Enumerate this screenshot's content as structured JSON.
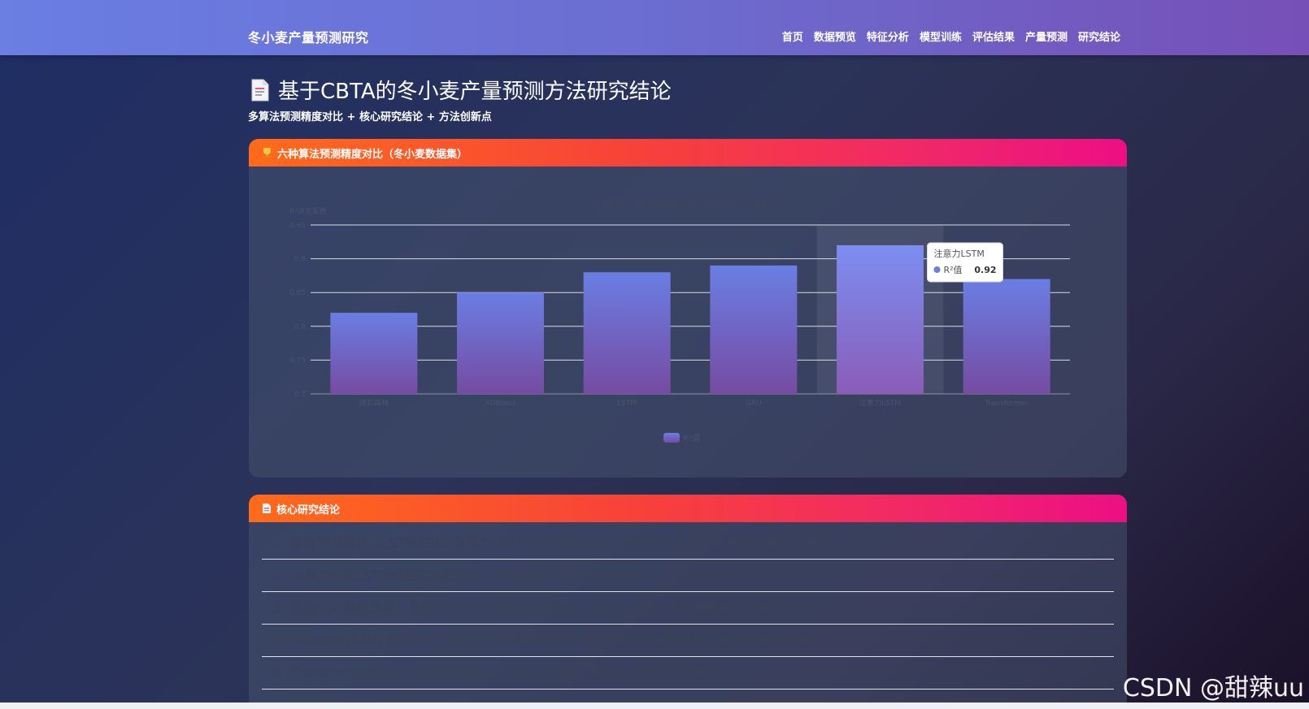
{
  "nav": {
    "brand": "冬小麦产量预测研究",
    "links": [
      "首页",
      "数据预览",
      "特征分析",
      "模型训练",
      "评估结果",
      "产量预测",
      "研究结论"
    ]
  },
  "page": {
    "title": "基于CBTA的冬小麦产量预测方法研究结论",
    "subtitle": "多算法预测精度对比 + 核心研究结论 + 方法创新点"
  },
  "chart_card": {
    "header": "六种算法预测精度对比（冬小麦数据集）",
    "header_icon": "trophy-icon"
  },
  "chart_data": {
    "type": "bar",
    "title": "六种算法预测精度对比 (R²越高越好)",
    "ylabel": "R²决定系数",
    "categories": [
      "随机森林",
      "XGBoost",
      "LSTM",
      "GRU",
      "注意力LSTM",
      "Transformer"
    ],
    "series": [
      {
        "name": "R²值",
        "values": [
          0.82,
          0.85,
          0.88,
          0.89,
          0.92,
          0.87
        ]
      }
    ],
    "ylim": [
      0.7,
      0.95
    ],
    "yticks": [
      "0.95",
      "0.9",
      "0.85",
      "0.8",
      "0.75",
      "0.7"
    ],
    "grid": true,
    "legend": "bottom-center",
    "bar_color_top": "#6a7ee3",
    "bar_color_bottom": "#764ba2",
    "tooltip": {
      "category": "注意力LSTM",
      "series": "R²值",
      "value": "0.92"
    }
  },
  "conclusions": {
    "header": "核心研究结论",
    "header_icon": "document-icon",
    "items": [
      "1. 深度学习算法（LSTM/GRU/注意力LSTM/Transformer）整体预测精度优于传统机器学习算法。",
      "2. 注意力机制LSTM模型在本数据集上表现最优，R²可达0.92以上，RMSE最低。",
      "3. 温度、土壤氮含量、湿度是影响冬小麦生长高度的三大核心特征，累计重要性占比超70%。",
      "4. XGBoost作为传统机器学习算法，预测精度接近LSTM，且训练速度更快，适合轻量化部署。",
      "5. Transformer模型在小样本数据集上泛化能力稍弱，但在大样本下潜力巨大。"
    ]
  },
  "watermark": "CSDN @甜辣uu"
}
